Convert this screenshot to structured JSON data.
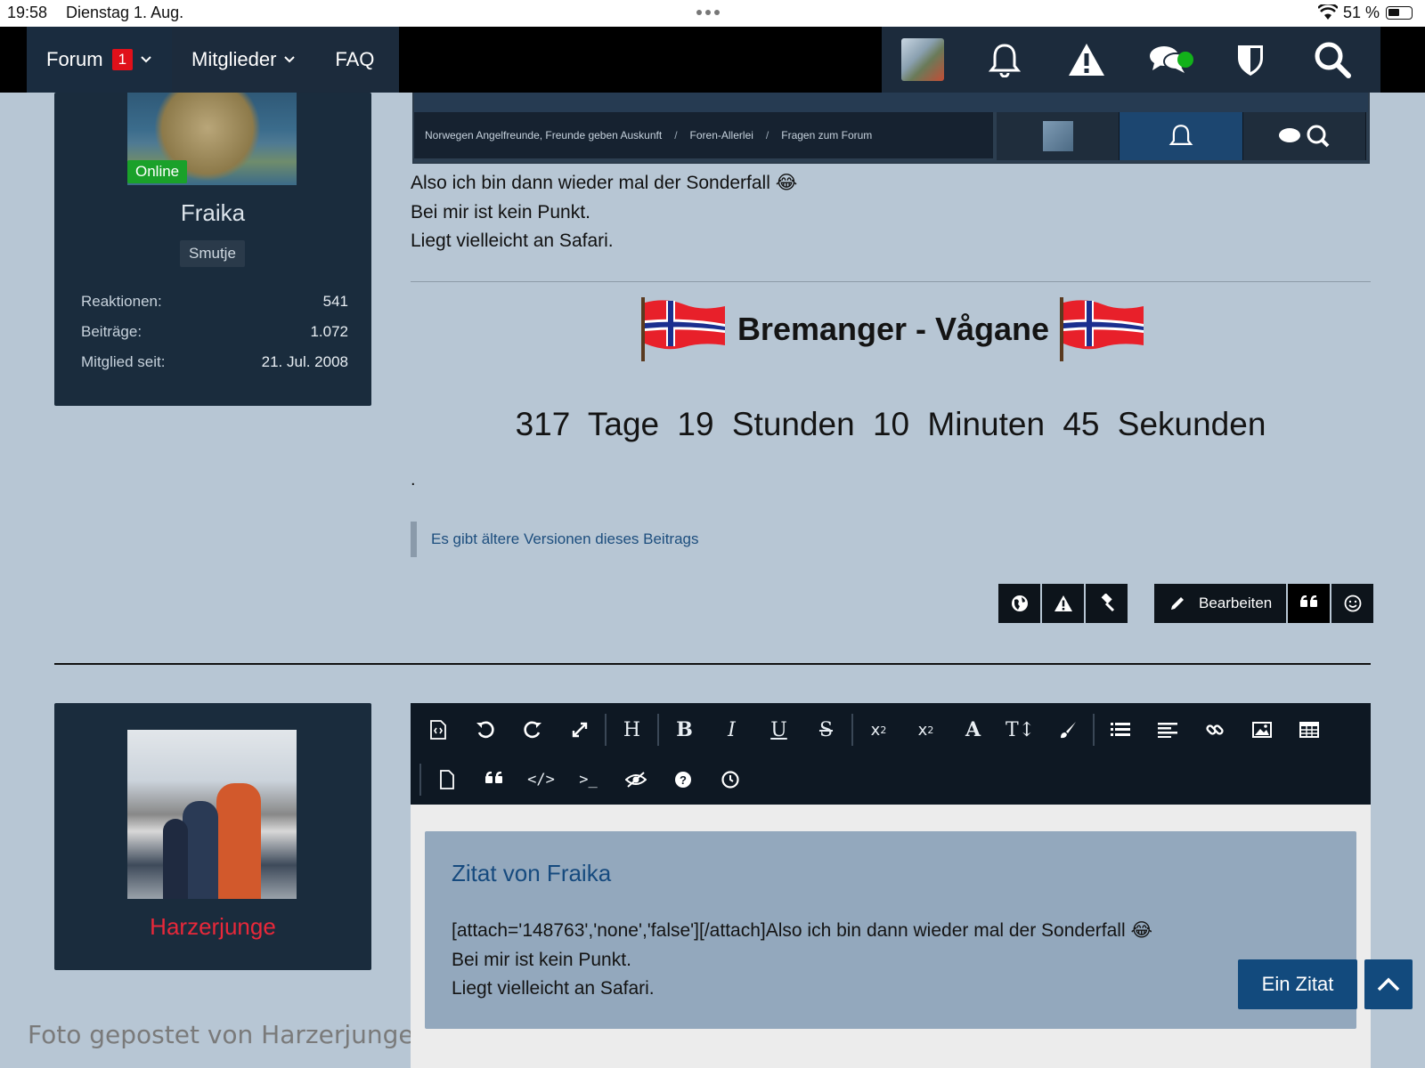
{
  "status_bar": {
    "time": "19:58",
    "date": "Dienstag 1. Aug.",
    "battery": "51 %"
  },
  "nav": {
    "tabs": [
      {
        "label": "Forum",
        "badge": "1"
      },
      {
        "label": "Mitglieder"
      },
      {
        "label": "FAQ"
      }
    ],
    "icons": [
      "avatar",
      "bell-icon",
      "warning-icon",
      "chat-icon",
      "shield-icon",
      "search-icon"
    ]
  },
  "post1": {
    "author": {
      "name": "Fraika",
      "online_label": "Online",
      "title": "Smutje"
    },
    "stats": [
      {
        "label": "Reaktionen:",
        "value": "541"
      },
      {
        "label": "Beiträge:",
        "value": "1.072"
      },
      {
        "label": "Mitglied seit:",
        "value": "21. Jul. 2008"
      }
    ],
    "embedded_breadcrumb": [
      "Norwegen Angelfreunde, Freunde geben Auskunft",
      "Foren-Allerlei",
      "Fragen zum Forum"
    ],
    "body_lines": [
      "Also ich bin dann wieder mal der Sonderfall 😂",
      "Bei mir ist kein Punkt.",
      "Liegt vielleicht an Safari."
    ],
    "signature_title": "Bremanger - Vågane",
    "countdown": "317  Tage   19  Stunden   10  Minuten   45  Sekunden",
    "dot": ".",
    "older_versions": "Es gibt ältere Versionen dieses Beitrags",
    "edit_label": "Bearbeiten"
  },
  "post2": {
    "author": {
      "name": "Harzerjunge"
    },
    "photo_caption": "Foto gepostet von Harzerjunge"
  },
  "editor": {
    "quote_title": "Zitat von Fraika",
    "quote_lines": [
      "[attach='148763','none','false'][/attach]Also ich bin dann wieder mal der Sonderfall 😂",
      "Bei mir ist kein Punkt.",
      "Liegt vielleicht an Safari."
    ],
    "ein_zitat": "Ein Zitat"
  },
  "colors": {
    "nav": "#000000",
    "card": "#1a2c3d",
    "link": "#1d4e7e",
    "accent": "#124a7d",
    "online": "#1aa12a",
    "badge": "#e0101a"
  }
}
